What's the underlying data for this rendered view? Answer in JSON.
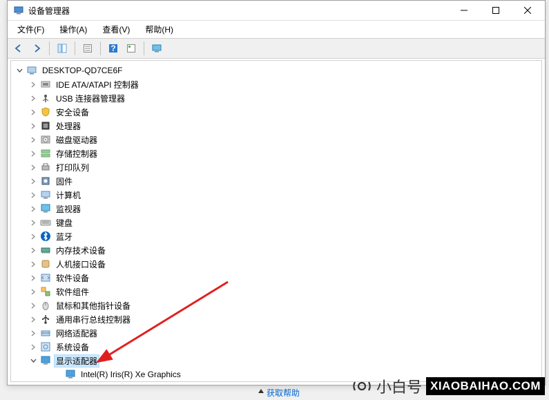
{
  "window": {
    "title": "设备管理器"
  },
  "menu": {
    "file": "文件(F)",
    "action": "操作(A)",
    "view": "查看(V)",
    "help": "帮助(H)"
  },
  "toolbar_icons": [
    "back",
    "forward",
    "sep",
    "up-tree",
    "sep",
    "properties",
    "sep",
    "help",
    "refresh",
    "sep",
    "monitor"
  ],
  "tree": {
    "root": "DESKTOP-QD7CE6F",
    "categories": [
      {
        "id": "ide",
        "label": "IDE ATA/ATAPI 控制器",
        "icon": "controller"
      },
      {
        "id": "usb",
        "label": "USB 连接器管理器",
        "icon": "usb"
      },
      {
        "id": "security",
        "label": "安全设备",
        "icon": "shield"
      },
      {
        "id": "cpu",
        "label": "处理器",
        "icon": "chip"
      },
      {
        "id": "disk",
        "label": "磁盘驱动器",
        "icon": "disk"
      },
      {
        "id": "storage",
        "label": "存储控制器",
        "icon": "storage"
      },
      {
        "id": "printqueue",
        "label": "打印队列",
        "icon": "printer"
      },
      {
        "id": "firmware",
        "label": "固件",
        "icon": "chip2"
      },
      {
        "id": "computer",
        "label": "计算机",
        "icon": "pc"
      },
      {
        "id": "monitor",
        "label": "监视器",
        "icon": "monitor"
      },
      {
        "id": "keyboard",
        "label": "键盘",
        "icon": "keyboard"
      },
      {
        "id": "bluetooth",
        "label": "蓝牙",
        "icon": "bluetooth"
      },
      {
        "id": "memory",
        "label": "内存技术设备",
        "icon": "memory"
      },
      {
        "id": "hid",
        "label": "人机接口设备",
        "icon": "hid"
      },
      {
        "id": "swdev",
        "label": "软件设备",
        "icon": "swdev"
      },
      {
        "id": "swcomp",
        "label": "软件组件",
        "icon": "swcomp"
      },
      {
        "id": "mouse",
        "label": "鼠标和其他指针设备",
        "icon": "mouse"
      },
      {
        "id": "usbctrl",
        "label": "通用串行总线控制器",
        "icon": "usbctrl"
      },
      {
        "id": "network",
        "label": "网络适配器",
        "icon": "network"
      },
      {
        "id": "system",
        "label": "系统设备",
        "icon": "system"
      },
      {
        "id": "display",
        "label": "显示适配器",
        "icon": "display",
        "expanded": true,
        "selected": true,
        "children": [
          {
            "label": "Intel(R) Iris(R) Xe Graphics",
            "icon": "display"
          }
        ]
      }
    ]
  },
  "brand": {
    "cn": "小白号",
    "domain": "XIAOBAIHAO.COM"
  },
  "watermark_text": "@小白号   XIAOBAIHAO.COM",
  "footer_help": "获取帮助"
}
